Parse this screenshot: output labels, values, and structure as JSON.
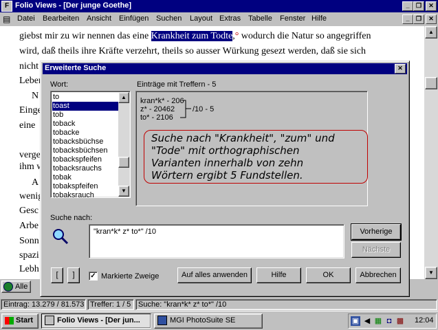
{
  "app": {
    "title": "Folio Views - [Der junge Goethe]",
    "menu": [
      "Datei",
      "Bearbeiten",
      "Ansicht",
      "Einfügen",
      "Suchen",
      "Layout",
      "Extras",
      "Tabelle",
      "Fenster",
      "Hilfe"
    ]
  },
  "document": {
    "line1_before": "giebst mir zu wir nennen das eine ",
    "line1_highlight": "Krankheit zum Todte",
    "line1_comma": ",",
    "line1_mark": "°",
    "line1_after": " wodurch die Natur so angegriffen",
    "line2": "wird, daß theils ihre Kräfte verzehrt, theils so ausser Würkung gesezt werden, daß sie sich",
    "line3": "nicht",
    "line4": "Leben",
    "line5": "N",
    "line6": "Einge",
    "line7": "eine",
    "line8": "verge",
    "line9": "ihm w",
    "line10": "A",
    "line11": "wenig",
    "line12": "Gesc",
    "line13": "Arbe",
    "line14": "Sonn",
    "line15": "spazi",
    "line16": "Lebh"
  },
  "tabs": [
    "Alle"
  ],
  "status": {
    "entry": "Eintrag: 13.279 / 81.573",
    "hits": "Treffer: 1 / 5",
    "search": "Suche: \"kran*k* z* to*\" /10"
  },
  "dialog": {
    "title": "Erweiterte Suche",
    "word_label": "Wort:",
    "words": [
      "to",
      "toast",
      "tob",
      "toback",
      "tobacke",
      "tobacksbüchse",
      "tobacksbüchsen",
      "tobackspfeifen",
      "tobacksrauchs",
      "tobak",
      "tobakspfeifen",
      "tobaksrauch"
    ],
    "selected_index": 1,
    "hits_label": "Einträge mit Treffern - 5",
    "hit_terms": [
      "kran*k* - 206",
      "z* - 20462",
      "to* - 2106"
    ],
    "hit_combined": "/10 - 5",
    "callout_lines": [
      "Suche nach \"Krankheit\", \"zum\" und",
      "\"Tode\" mit orthographischen",
      "Varianten innerhalb von zehn",
      "Wörtern ergibt 5 Fundstellen."
    ],
    "search_label": "Suche nach:",
    "query": "\"kran*k* z* to*\" /10",
    "btn_prev": "Vorherige",
    "btn_next": "Nächste",
    "btn_open_bracket": "[",
    "btn_close_bracket": "]",
    "checkbox_label": "Markierte Zweige",
    "checkbox_checked": true,
    "btn_apply_all": "Auf alles anwenden",
    "btn_help": "Hilfe",
    "btn_ok": "OK",
    "btn_cancel": "Abbrechen"
  },
  "taskbar": {
    "start": "Start",
    "task1": "Folio Views - [Der jun...",
    "task2": "MGI PhotoSuite SE",
    "clock": "12:04"
  }
}
